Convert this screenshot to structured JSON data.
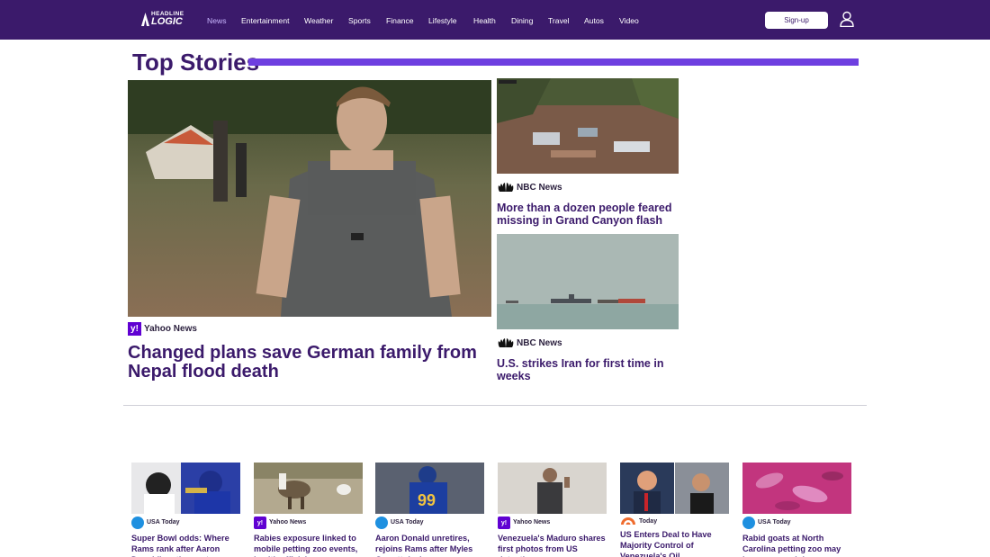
{
  "brand": {
    "line1": "HEADLINE",
    "line2": "LOGIC"
  },
  "nav": {
    "items": [
      {
        "label": "News",
        "active": true
      },
      {
        "label": "Entertainment"
      },
      {
        "label": "Weather"
      },
      {
        "label": "Sports"
      },
      {
        "label": "Finance"
      },
      {
        "label": "Lifestyle"
      },
      {
        "label": "Health"
      },
      {
        "label": "Dining"
      },
      {
        "label": "Travel"
      },
      {
        "label": "Autos"
      },
      {
        "label": "Video"
      }
    ],
    "signup_label": "Sign-up"
  },
  "section": {
    "title": "Top Stories"
  },
  "hero": {
    "source": "Yahoo News",
    "headline": "Changed plans save German family from Nepal flood death"
  },
  "side": [
    {
      "source": "NBC News",
      "headline": "More than a dozen people feared missing in Grand Canyon flash flood"
    },
    {
      "source": "NBC News",
      "headline": "U.S. strikes Iran for first time in weeks"
    }
  ],
  "cards": [
    {
      "source": "USA Today",
      "title": "Super Bowl odds: Where Rams rank after Aaron Donald's retirement"
    },
    {
      "source": "Yahoo News",
      "title": "Rabies exposure linked to mobile petting zoo events, health officials say"
    },
    {
      "source": "USA Today",
      "title": "Aaron Donald unretires, rejoins Rams after Myles Garrett deal"
    },
    {
      "source": "Yahoo News",
      "title": "Venezuela's Maduro shares first photos from US detention"
    },
    {
      "source": "Today",
      "title": "US Enters Deal to Have Majority Control of Venezuela's Oil"
    },
    {
      "source": "USA Today",
      "title": "Rabid goats at North Carolina petting zoo may have exposed dozens"
    }
  ],
  "colors": {
    "nav_bg": "#3b1a6b",
    "accent_bar": "#6e3fe0",
    "headline": "#3b1a6b",
    "yahoo": "#6001d2",
    "usa_today": "#1e90e0"
  }
}
